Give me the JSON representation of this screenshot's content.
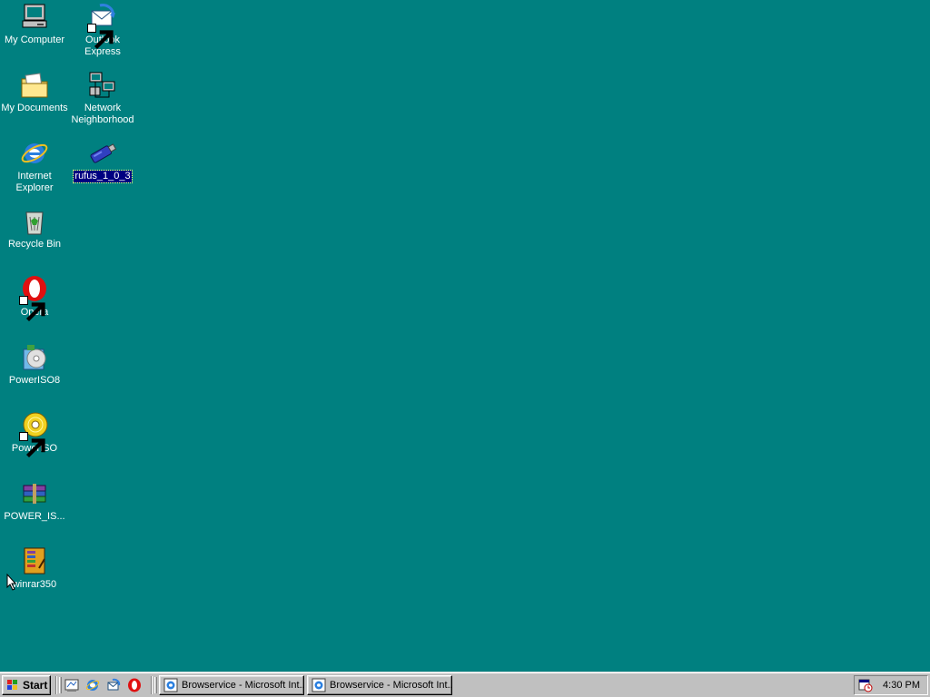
{
  "desktop": {
    "background": "#008080",
    "icons": [
      {
        "name": "My Computer",
        "icon": "computer-icon"
      },
      {
        "name": "Outlook Express",
        "icon": "outlook-express-icon",
        "shortcut": true
      },
      {
        "name": "My Documents",
        "icon": "folder-documents-icon"
      },
      {
        "name": "Network Neighborhood",
        "icon": "network-icon"
      },
      {
        "name": "Internet Explorer",
        "icon": "internet-explorer-icon"
      },
      {
        "name": "rufus_1_0_3",
        "icon": "usb-drive-icon",
        "selected": true
      },
      {
        "name": "Recycle Bin",
        "icon": "recycle-bin-icon"
      },
      {
        "name": "Opera",
        "icon": "opera-icon",
        "shortcut": true
      },
      {
        "name": "PowerISO8",
        "icon": "poweriso-installer-icon"
      },
      {
        "name": "PowerISO",
        "icon": "poweriso-disc-icon",
        "shortcut": true
      },
      {
        "name": "POWER_IS...",
        "icon": "winrar-archive-icon"
      },
      {
        "name": "winrar350",
        "icon": "winrar-installer-icon"
      }
    ]
  },
  "taskbar": {
    "start_label": "Start",
    "quick_launch": [
      "show-desktop-icon",
      "internet-explorer-icon",
      "outlook-express-icon",
      "opera-icon"
    ],
    "tasks": [
      {
        "label": "Browservice - Microsoft Int...",
        "icon": "internet-explorer-icon"
      },
      {
        "label": "Browservice - Microsoft Int...",
        "icon": "internet-explorer-icon"
      }
    ],
    "tray": {
      "icon": "scheduler-icon",
      "clock": "4:30 PM"
    }
  }
}
